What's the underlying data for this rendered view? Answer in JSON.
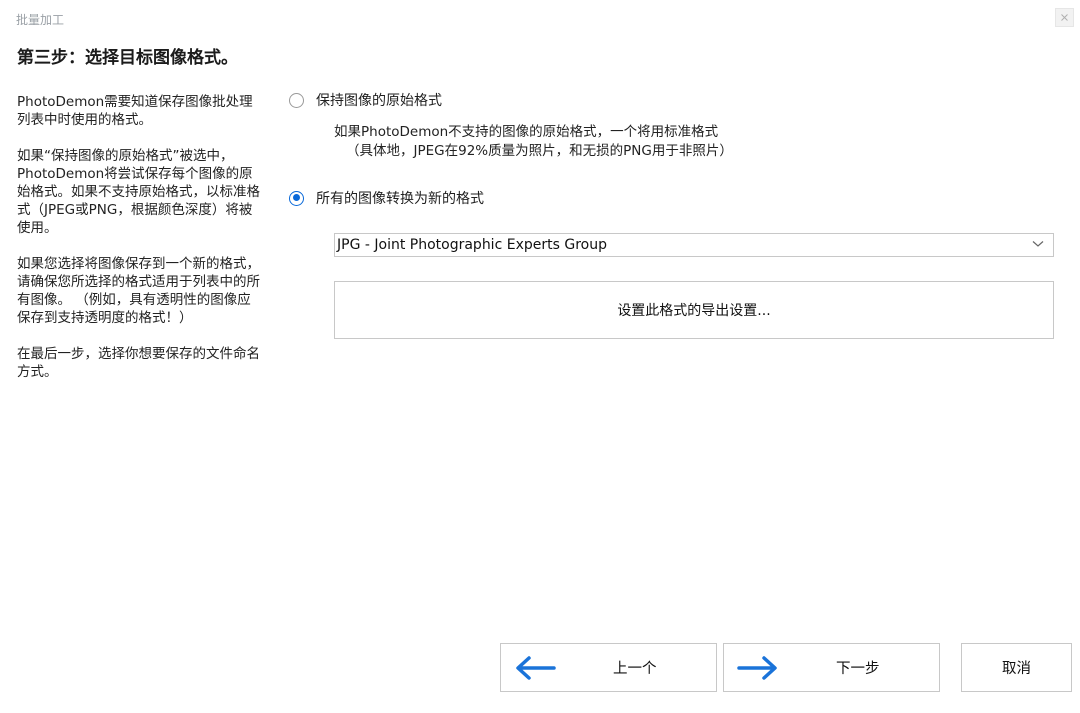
{
  "window": {
    "title": "批量加工"
  },
  "step_title": "第三步：选择目标图像格式。",
  "help": {
    "paragraphs": [
      "PhotoDemon需要知道保存图像批处理列表中时使用的格式。",
      "如果“保持图像的原始格式”被选中，PhotoDemon将尝试保存每个图像的原始格式。如果不支持原始格式，以标准格式（JPEG或PNG，根据颜色深度）将被使用。",
      "如果您选择将图像保存到一个新的格式，请确保您所选择的格式适用于列表中的所有图像。 （例如，具有透明性的图像应保存到支持透明度的格式！）",
      "在最后一步，选择你想要保存的文件命名方式。"
    ]
  },
  "options": {
    "keep_original": {
      "label": "保持图像的原始格式",
      "checked": false,
      "description": [
        "如果PhotoDemon不支持的图像的原始格式，一个将用标准格式",
        "（具体地，JPEG在92%质量为照片，和无损的PNG用于非照片）"
      ]
    },
    "convert_all": {
      "label": "所有的图像转换为新的格式",
      "checked": true
    }
  },
  "format_select": {
    "selected": "JPG - Joint Photographic Experts Group"
  },
  "export_settings_button": "设置此格式的导出设置...",
  "footer": {
    "back_label": "上一个",
    "next_label": "下一步",
    "cancel_label": "取消"
  },
  "colors": {
    "accent": "#0a69d9",
    "arrow": "#1a73d9",
    "border": "#c8c8c8"
  }
}
